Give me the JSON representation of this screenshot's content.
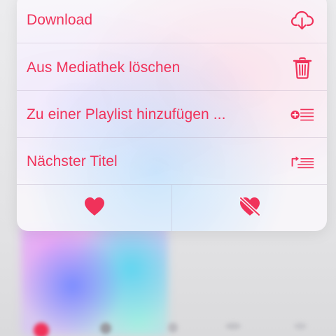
{
  "context_menu": {
    "items": [
      {
        "label": "Download",
        "icon": "cloud-download-icon"
      },
      {
        "label": "Aus Mediathek löschen",
        "icon": "trash-icon"
      },
      {
        "label": "Zu einer Playlist hinzufügen ...",
        "icon": "add-to-playlist-icon"
      },
      {
        "label": "Nächster Titel",
        "icon": "play-next-icon"
      }
    ],
    "reactions": [
      {
        "icon": "heart-icon"
      },
      {
        "icon": "heart-dislike-icon"
      }
    ]
  },
  "colors": {
    "accent": "#f0325a",
    "menu_background": "#f7f5f9",
    "separator": "#d8d2de"
  }
}
